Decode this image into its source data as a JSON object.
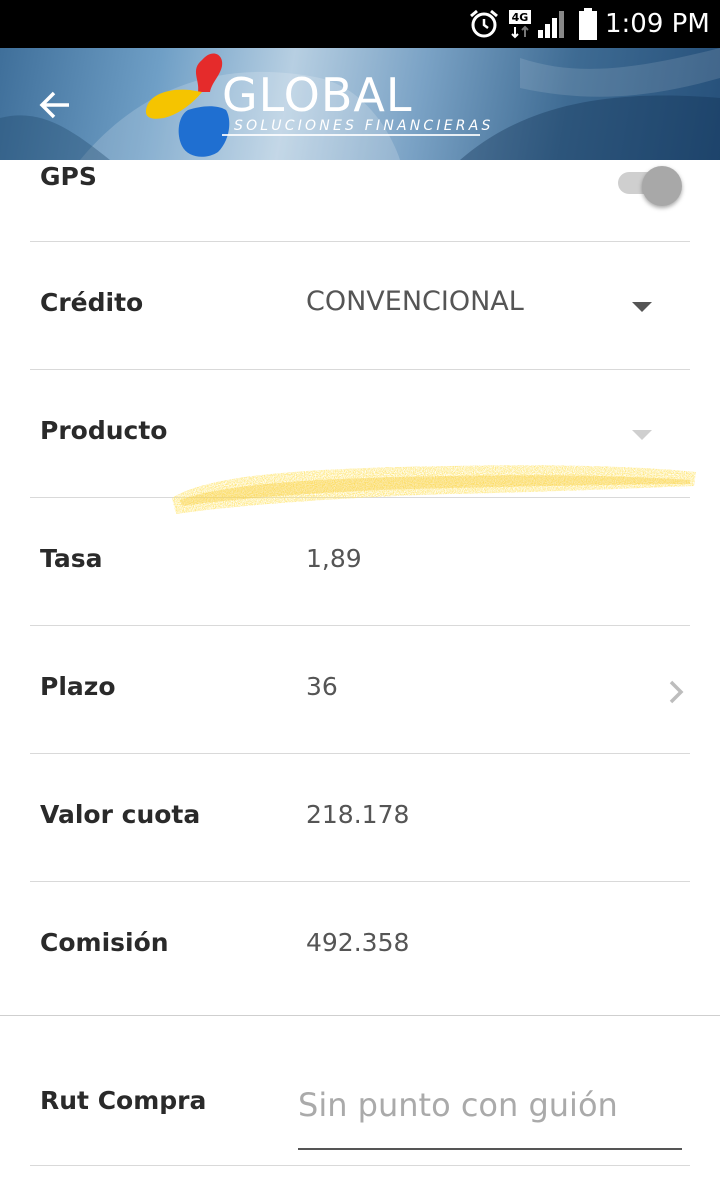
{
  "status_bar": {
    "time": "1:09 PM",
    "network": "4G",
    "icons": [
      "alarm-icon",
      "network-4g-icon",
      "signal-icon",
      "battery-icon"
    ]
  },
  "header": {
    "back_icon": "arrow-left-icon",
    "brand": "GLOBAL",
    "tagline": "SOLUCIONES FINANCIERAS",
    "colors": {
      "red": "#e52b2b",
      "yellow": "#f5c400",
      "blue": "#1f6fd1"
    }
  },
  "form": {
    "gps": {
      "label": "GPS",
      "enabled": false
    },
    "credito": {
      "label": "Crédito",
      "value": "CONVENCIONAL"
    },
    "producto": {
      "label": "Producto",
      "value": ""
    },
    "tasa": {
      "label": "Tasa",
      "value": "1,89"
    },
    "plazo": {
      "label": "Plazo",
      "value": "36"
    },
    "valor_cuota": {
      "label": "Valor cuota",
      "value": "218.178"
    },
    "comision": {
      "label": "Comisión",
      "value": "492.358"
    },
    "rut_compra": {
      "label": "Rut Compra",
      "placeholder": "Sin punto con guión",
      "value": ""
    }
  }
}
